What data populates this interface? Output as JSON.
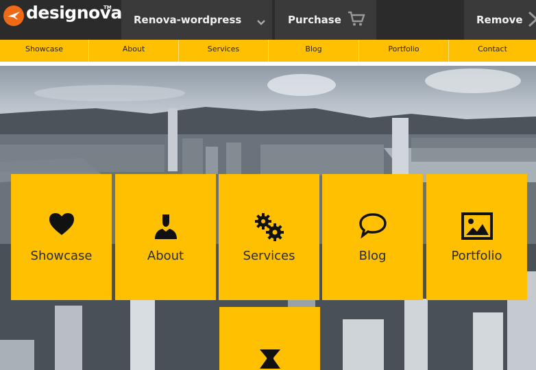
{
  "topbar": {
    "logo_text": "designova",
    "logo_tm": "TM",
    "project": "Renova-wordpress",
    "purchase": "Purchase",
    "remove": "Remove"
  },
  "nav": {
    "items": [
      "Showcase",
      "About",
      "Services",
      "Blog",
      "Portfolio",
      "Contact"
    ]
  },
  "tiles": [
    {
      "label": "Showcase",
      "icon": "heart-icon"
    },
    {
      "label": "About",
      "icon": "person-icon"
    },
    {
      "label": "Services",
      "icon": "gears-icon"
    },
    {
      "label": "Blog",
      "icon": "speech-bubble-icon"
    },
    {
      "label": "Portfolio",
      "icon": "image-icon"
    }
  ],
  "colors": {
    "accent": "#fec000",
    "topbar": "#2b2b2b",
    "topbar_item": "#3a3a3a",
    "logo_orange": "#ef6a16"
  }
}
